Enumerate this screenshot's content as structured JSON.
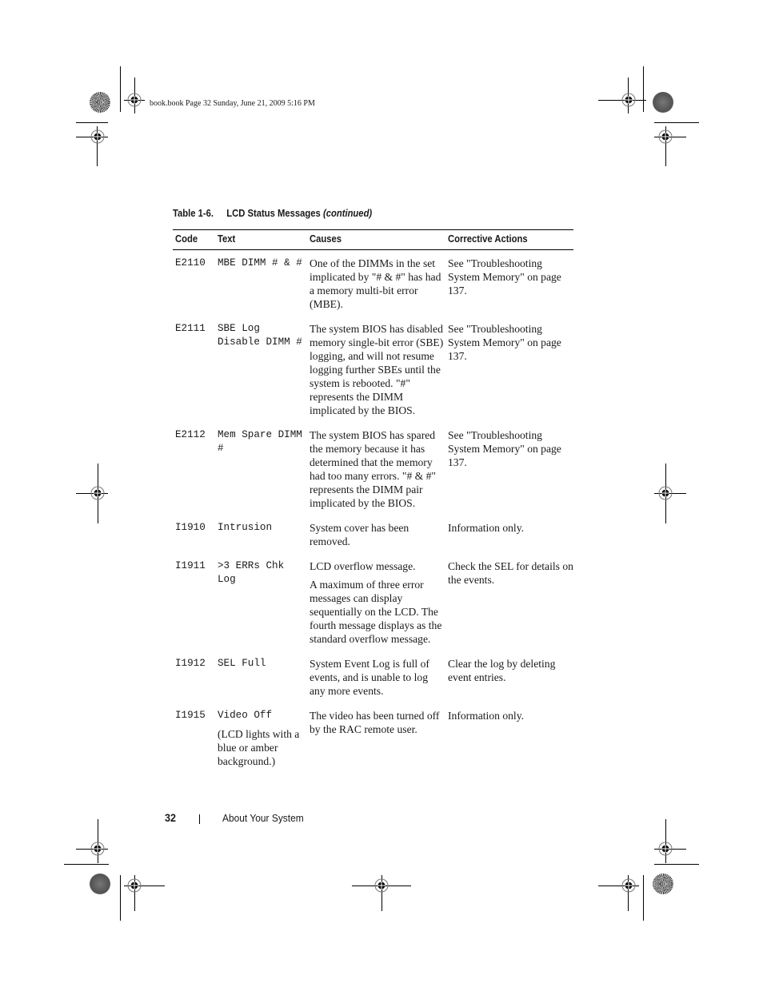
{
  "header": {
    "slug": "book.book  Page 32  Sunday, June 21, 2009  5:16 PM"
  },
  "table": {
    "caption_label": "Table 1-6.",
    "caption_title": "LCD Status Messages",
    "caption_suffix": "(continued)",
    "columns": [
      "Code",
      "Text",
      "Causes",
      "Corrective Actions"
    ],
    "rows": [
      {
        "code": "E2110",
        "text": "MBE DIMM # & #",
        "text_note": "",
        "causes": [
          "One of the DIMMs in the set implicated by \"# & #\" has had a memory multi-bit error (MBE)."
        ],
        "actions": "See \"Troubleshooting System Memory\" on page 137."
      },
      {
        "code": "E2111",
        "text": "SBE Log Disable DIMM #",
        "text_note": "",
        "causes": [
          "The system BIOS has disabled memory single-bit error (SBE) logging, and will not resume logging further SBEs until the system is rebooted. \"#\" represents the DIMM implicated by the BIOS."
        ],
        "actions": "See \"Troubleshooting System Memory\" on page 137."
      },
      {
        "code": "E2112",
        "text": "Mem Spare DIMM #",
        "text_note": "",
        "causes": [
          "The system BIOS has spared the memory because it has determined that the memory had too many errors. \"# & #\" represents the DIMM pair implicated by the BIOS."
        ],
        "actions": "See \"Troubleshooting System Memory\" on page 137."
      },
      {
        "code": "I1910",
        "text": "Intrusion",
        "text_note": "",
        "causes": [
          "System cover has been removed."
        ],
        "actions": "Information only."
      },
      {
        "code": "I1911",
        "text": ">3 ERRs Chk Log",
        "text_note": "",
        "causes": [
          "LCD overflow message.",
          "A maximum of three error messages can display sequentially on the LCD. The fourth message displays as the standard overflow message."
        ],
        "actions": "Check the SEL for details on the events."
      },
      {
        "code": "I1912",
        "text": "SEL Full",
        "text_note": "",
        "causes": [
          "System Event Log is full of events, and is unable to log any more events."
        ],
        "actions": "Clear the log by deleting event entries."
      },
      {
        "code": "I1915",
        "text": "Video Off",
        "text_note": "(LCD lights with a blue or amber background.)",
        "causes": [
          "The video has been turned off by the RAC remote user."
        ],
        "actions": "Information only."
      }
    ]
  },
  "footer": {
    "page_number": "32",
    "section_title": "About Your System"
  }
}
